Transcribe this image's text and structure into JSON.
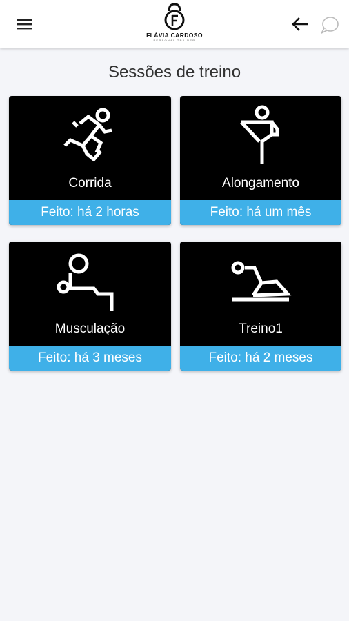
{
  "app": {
    "logo_name": "FLÁVIA CARDOSO",
    "logo_subtitle": "PERSONAL TRAINER",
    "icons": {
      "menu": "hamburger-menu-icon",
      "back": "arrow-left-icon",
      "chat": "chat-bubble-icon"
    }
  },
  "page": {
    "title": "Sessões de treino"
  },
  "sessions": [
    {
      "label": "Corrida",
      "status": "Feito: há 2 horas",
      "icon": "running-icon"
    },
    {
      "label": "Alongamento",
      "status": "Feito: há um mês",
      "icon": "stretching-icon"
    },
    {
      "label": "Musculação",
      "status": "Feito: há 3 meses",
      "icon": "weightlifting-icon"
    },
    {
      "label": "Treino1",
      "status": "Feito: há 2 meses",
      "icon": "floor-exercise-icon"
    }
  ],
  "colors": {
    "accent": "#3fb0e8",
    "card_bg": "#000000",
    "page_bg": "#f4f5f9"
  }
}
